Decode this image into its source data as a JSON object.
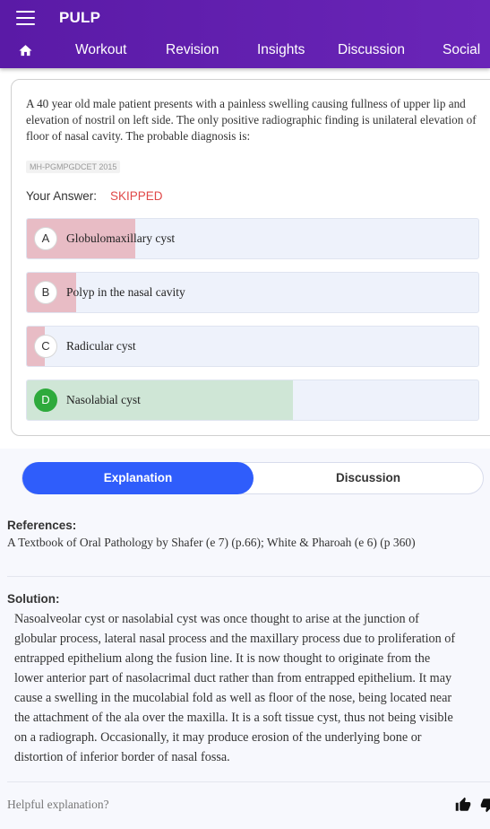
{
  "app": {
    "title": "PULP"
  },
  "nav": {
    "tabs": [
      "Workout",
      "Revision",
      "Insights",
      "Discussion",
      "Social"
    ]
  },
  "question": {
    "text": "A 40 year old male patient presents with a painless swelling causing fullness of upper lip and elevation of nostril on left side. The only positive radiographic finding is unilateral elevation of floor of nasal cavity. The probable diagnosis is:",
    "tag": "MH-PGMPGDCET 2015",
    "your_answer_label": "Your Answer:",
    "your_answer_value": "SKIPPED",
    "options": [
      {
        "letter": "A",
        "text": "Globulomaxillary cyst",
        "fraction": 0.24,
        "correct": false
      },
      {
        "letter": "B",
        "text": "Polyp in the nasal cavity",
        "fraction": 0.11,
        "correct": false
      },
      {
        "letter": "C",
        "text": "Radicular cyst",
        "fraction": 0.04,
        "correct": false
      },
      {
        "letter": "D",
        "text": "Nasolabial cyst",
        "fraction": 0.59,
        "correct": true
      }
    ]
  },
  "tabs": {
    "explanation": "Explanation",
    "discussion": "Discussion"
  },
  "references": {
    "heading": "References:",
    "text": "A Textbook of Oral Pathology by Shafer (e 7) (p.66); White & Pharoah (e 6) (p 360)"
  },
  "solution": {
    "heading": "Solution:",
    "text": "Nasoalveolar cyst or nasolabial cyst was once thought to arise at the junction of\nglobular process, lateral nasal process and the maxillary process due to proliferation of\nentrapped epithelium along the fusion line. It is now thought to originate from the\nlower anterior part of nasolacrimal duct rather than from entrapped epithelium. It may\ncause a swelling in the mucolabial fold as well as floor of the nose, being located near\nthe attachment of the ala over the maxilla. It is a soft tissue cyst, thus not being visible\non a radiograph. Occasionally, it may produce erosion of the underlying bone or\ndistortion of inferior border of nasal fossa."
  },
  "feedback": {
    "prompt": "Helpful explanation?"
  },
  "colors": {
    "wrong_fill": "#e8bcc5",
    "correct_fill": "#cfe6d6",
    "accent": "#2f5dfb",
    "header": "#5c1ba8"
  }
}
